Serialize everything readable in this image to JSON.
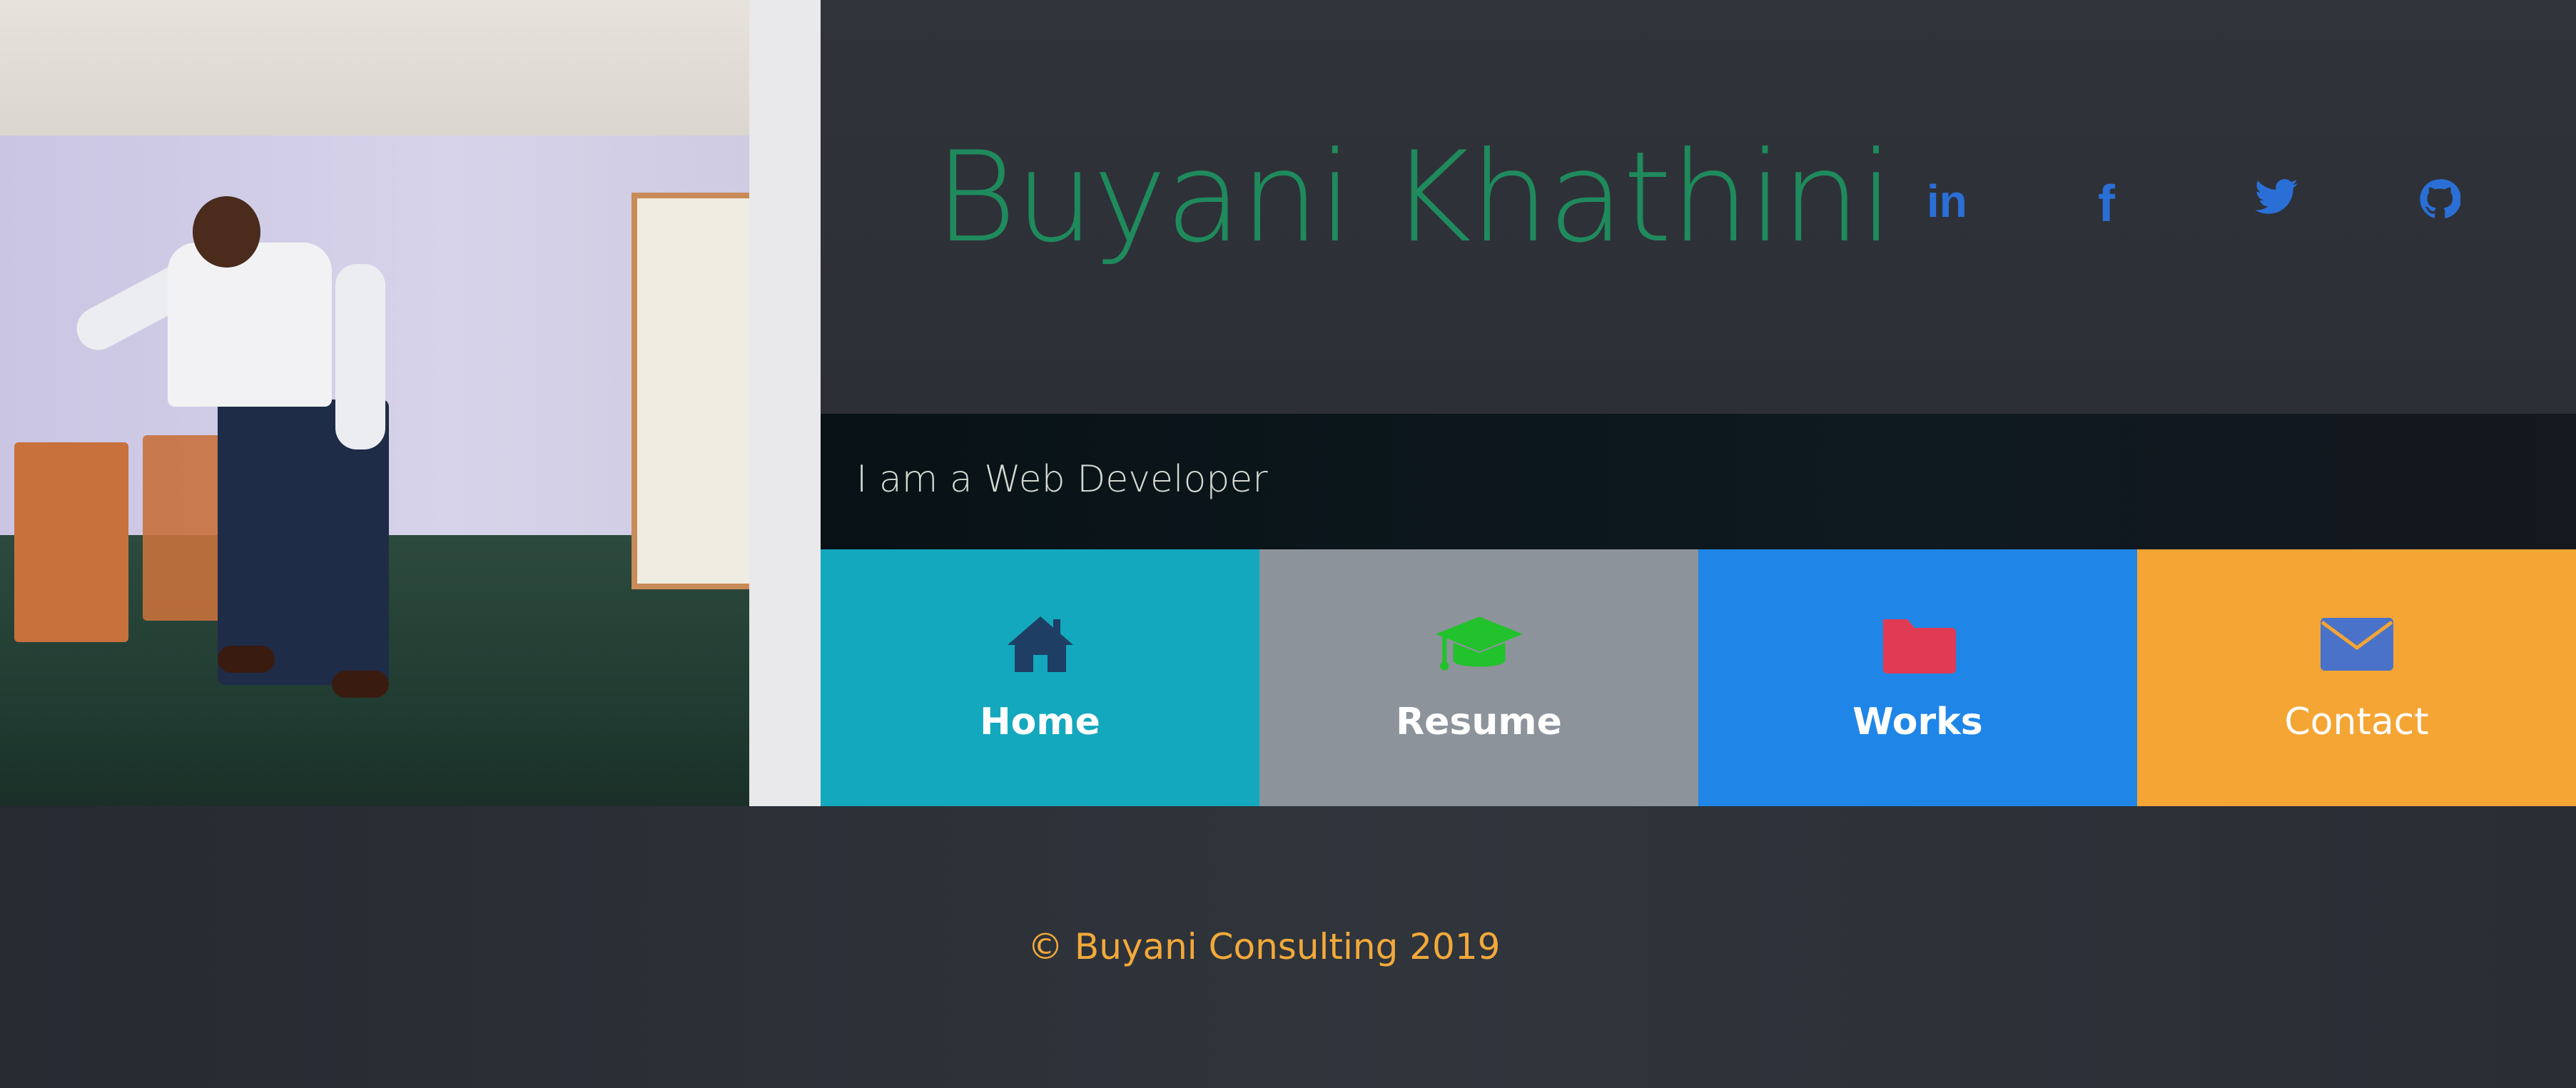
{
  "profile_photo": {
    "icon": "person-photo"
  },
  "header": {
    "name": "Buyani Khathini",
    "social": [
      {
        "label": "in",
        "icon": "linkedin-icon",
        "color": "#2a6fd6"
      },
      {
        "label": "f",
        "icon": "facebook-icon",
        "color": "#2a6fd6"
      },
      {
        "icon": "twitter-icon",
        "color": "#2a6fd6"
      },
      {
        "icon": "github-icon",
        "color": "#2a6fd6"
      }
    ],
    "name_color": "#1f8a5c"
  },
  "tagline": "I am a Web Developer",
  "nav": [
    {
      "label": "Home",
      "icon": "home-icon",
      "bg": "#13a8bd"
    },
    {
      "label": "Resume",
      "icon": "graduation-cap-icon",
      "bg": "#8d939a"
    },
    {
      "label": "Works",
      "icon": "folder-icon",
      "bg": "#1f86e8"
    },
    {
      "label": "Contact",
      "icon": "envelope-icon",
      "bg": "#f4a534"
    }
  ],
  "footer": {
    "copyright": "© Buyani Consulting 2019",
    "text_color": "#f2a93a"
  }
}
